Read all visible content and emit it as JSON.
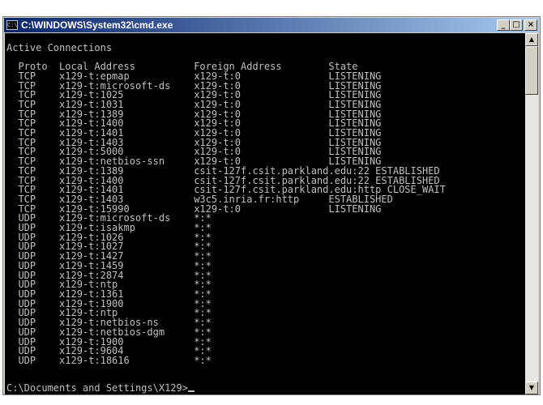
{
  "window": {
    "title": "C:\\WINDOWS\\System32\\cmd.exe",
    "icon_label": "C:\\",
    "minimize_label": "_",
    "maximize_label": "□",
    "close_label": "×"
  },
  "console": {
    "heading": "Active Connections",
    "columns": [
      "Proto",
      "Local Address",
      "Foreign Address",
      "State"
    ],
    "rows": [
      [
        "TCP",
        "x129-t:epmap",
        "x129-t:0",
        "LISTENING"
      ],
      [
        "TCP",
        "x129-t:microsoft-ds",
        "x129-t:0",
        "LISTENING"
      ],
      [
        "TCP",
        "x129-t:1025",
        "x129-t:0",
        "LISTENING"
      ],
      [
        "TCP",
        "x129-t:1031",
        "x129-t:0",
        "LISTENING"
      ],
      [
        "TCP",
        "x129-t:1389",
        "x129-t:0",
        "LISTENING"
      ],
      [
        "TCP",
        "x129-t:1400",
        "x129-t:0",
        "LISTENING"
      ],
      [
        "TCP",
        "x129-t:1401",
        "x129-t:0",
        "LISTENING"
      ],
      [
        "TCP",
        "x129-t:1403",
        "x129-t:0",
        "LISTENING"
      ],
      [
        "TCP",
        "x129-t:5000",
        "x129-t:0",
        "LISTENING"
      ],
      [
        "TCP",
        "x129-t:netbios-ssn",
        "x129-t:0",
        "LISTENING"
      ],
      [
        "TCP",
        "x129-t:1389",
        "csit-127f.csit.parkland.edu:22",
        "ESTABLISHED"
      ],
      [
        "TCP",
        "x129-t:1400",
        "csit-127f.csit.parkland.edu:22",
        "ESTABLISHED"
      ],
      [
        "TCP",
        "x129-t:1401",
        "csit-127f.csit.parkland.edu:http",
        "CLOSE_WAIT"
      ],
      [
        "TCP",
        "x129-t:1403",
        "w3c5.inria.fr:http",
        "ESTABLISHED"
      ],
      [
        "TCP",
        "x129-t:15990",
        "x129-t:0",
        "LISTENING"
      ],
      [
        "UDP",
        "x129-t:microsoft-ds",
        "*:*",
        ""
      ],
      [
        "UDP",
        "x129-t:isakmp",
        "*:*",
        ""
      ],
      [
        "UDP",
        "x129-t:1026",
        "*:*",
        ""
      ],
      [
        "UDP",
        "x129-t:1027",
        "*:*",
        ""
      ],
      [
        "UDP",
        "x129-t:1427",
        "*:*",
        ""
      ],
      [
        "UDP",
        "x129-t:1459",
        "*:*",
        ""
      ],
      [
        "UDP",
        "x129-t:2874",
        "*:*",
        ""
      ],
      [
        "UDP",
        "x129-t:ntp",
        "*:*",
        ""
      ],
      [
        "UDP",
        "x129-t:1361",
        "*:*",
        ""
      ],
      [
        "UDP",
        "x129-t:1900",
        "*:*",
        ""
      ],
      [
        "UDP",
        "x129-t:ntp",
        "*:*",
        ""
      ],
      [
        "UDP",
        "x129-t:netbios-ns",
        "*:*",
        ""
      ],
      [
        "UDP",
        "x129-t:netbios-dgm",
        "*:*",
        ""
      ],
      [
        "UDP",
        "x129-t:1900",
        "*:*",
        ""
      ],
      [
        "UDP",
        "x129-t:9604",
        "*:*",
        ""
      ],
      [
        "UDP",
        "x129-t:18616",
        "*:*",
        ""
      ]
    ],
    "prompt": "C:\\Documents and Settings\\X129>"
  },
  "scrollbar": {
    "up_icon": "▲",
    "down_icon": "▼"
  },
  "colors": {
    "titlebar_start": "#0a246a",
    "titlebar_end": "#a6caf0",
    "console_bg": "#000000",
    "console_text": "#c0c0c0"
  }
}
